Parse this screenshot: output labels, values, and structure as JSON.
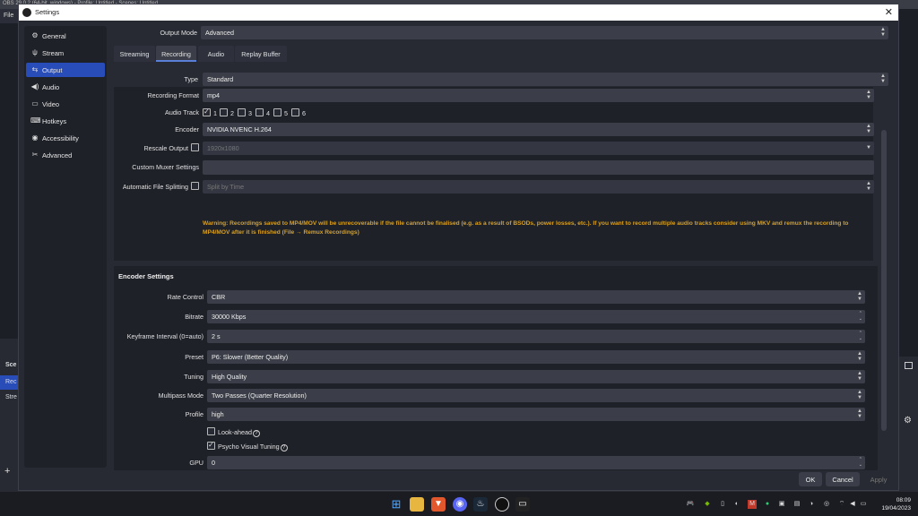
{
  "background": {
    "titlebar_text": "OBS 29.0.2 (64-bit, windows) - Profile: Untitled - Scenes: Untitled",
    "menu_file": "File",
    "left_items": [
      "Sce",
      "Rec",
      "Stre"
    ]
  },
  "dialog": {
    "title": "Settings",
    "close_label": "✕"
  },
  "sidebar": {
    "items": [
      {
        "label": "General",
        "icon": "⚙"
      },
      {
        "label": "Stream",
        "icon": "📡"
      },
      {
        "label": "Output",
        "icon": "⇆"
      },
      {
        "label": "Audio",
        "icon": "🔊"
      },
      {
        "label": "Video",
        "icon": "▭"
      },
      {
        "label": "Hotkeys",
        "icon": "⌨"
      },
      {
        "label": "Accessibility",
        "icon": "◉"
      },
      {
        "label": "Advanced",
        "icon": "✂"
      }
    ],
    "active_index": 2
  },
  "output": {
    "mode_label": "Output Mode",
    "mode_value": "Advanced",
    "tabs": [
      "Streaming",
      "Recording",
      "Audio",
      "Replay Buffer"
    ],
    "active_tab": 1,
    "type_label": "Type",
    "type_value": "Standard",
    "recording_format_label": "Recording Format",
    "recording_format_value": "mp4",
    "audio_track_label": "Audio Track",
    "audio_tracks": [
      {
        "label": "1",
        "checked": true
      },
      {
        "label": "2",
        "checked": false
      },
      {
        "label": "3",
        "checked": false
      },
      {
        "label": "4",
        "checked": false
      },
      {
        "label": "5",
        "checked": false
      },
      {
        "label": "6",
        "checked": false
      }
    ],
    "encoder_label": "Encoder",
    "encoder_value": "NVIDIA NVENC H.264",
    "rescale_label": "Rescale Output",
    "rescale_value": "1920x1080",
    "muxer_label": "Custom Muxer Settings",
    "muxer_value": "",
    "splitting_label": "Automatic File Splitting",
    "splitting_value": "Split by Time",
    "warning": "Warning: Recordings saved to MP4/MOV will be unrecoverable if the file cannot be finalised (e.g. as a result of BSODs, power losses, etc.). If you want to record multiple audio tracks consider using MKV and remux the recording to MP4/MOV after it is finished (File → Remux Recordings)"
  },
  "encoder_settings": {
    "title": "Encoder Settings",
    "rate_control_label": "Rate Control",
    "rate_control_value": "CBR",
    "bitrate_label": "Bitrate",
    "bitrate_value": "30000 Kbps",
    "keyframe_label": "Keyframe Interval (0=auto)",
    "keyframe_value": "2 s",
    "preset_label": "Preset",
    "preset_value": "P6: Slower (Better Quality)",
    "tuning_label": "Tuning",
    "tuning_value": "High Quality",
    "multipass_label": "Multipass Mode",
    "multipass_value": "Two Passes (Quarter Resolution)",
    "profile_label": "Profile",
    "profile_value": "high",
    "lookahead_label": "Look-ahead",
    "lookahead_checked": false,
    "psycho_label": "Psycho Visual Tuning",
    "psycho_checked": true,
    "gpu_label": "GPU",
    "gpu_value": "0"
  },
  "footer": {
    "ok": "OK",
    "cancel": "Cancel",
    "apply": "Apply"
  },
  "taskbar": {
    "time": "08:09",
    "date": "19/04/2023"
  },
  "colors": {
    "accent": "#284cb8",
    "warning": "#d9a01e",
    "background": "#272a33"
  }
}
